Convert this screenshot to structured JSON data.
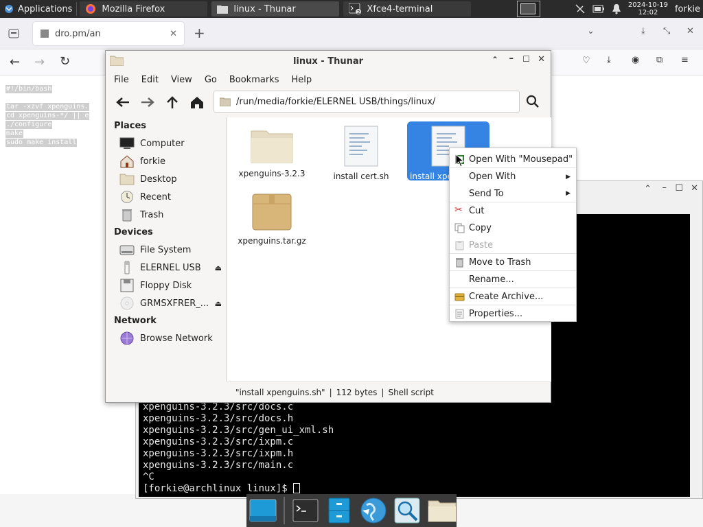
{
  "panel": {
    "applications": "Applications",
    "tasks": [
      {
        "label": "Mozilla Firefox"
      },
      {
        "label": "linux - Thunar"
      },
      {
        "label": "Xfce4-terminal"
      }
    ],
    "clock_date": "2024-10-19",
    "clock_time": "12:02",
    "user": "forkie"
  },
  "firefox": {
    "tab_title": "dro.pm/an",
    "content_lines": [
      "#!/bin/bash",
      "tar -xzvf xpenguins.",
      "cd xpenguins-*/ || e",
      "./configure",
      "make",
      "sudo make install"
    ]
  },
  "terminal": {
    "lines": [
      "xpenguins-3.2.3/src/docs.c",
      "xpenguins-3.2.3/src/docs.h",
      "xpenguins-3.2.3/src/gen_ui_xml.sh",
      "xpenguins-3.2.3/src/ixpm.c",
      "xpenguins-3.2.3/src/ixpm.h",
      "xpenguins-3.2.3/src/main.c",
      "^C",
      "[forkie@archlinux linux]$ "
    ]
  },
  "thunar": {
    "title": "linux - Thunar",
    "menu": [
      "File",
      "Edit",
      "View",
      "Go",
      "Bookmarks",
      "Help"
    ],
    "path": "/run/media/forkie/ELERNEL USB/things/linux/",
    "sidebar": {
      "places_heading": "Places",
      "places": [
        "Computer",
        "forkie",
        "Desktop",
        "Recent",
        "Trash"
      ],
      "devices_heading": "Devices",
      "devices": [
        "File System",
        "ELERNEL USB",
        "Floppy Disk",
        "GRMSXFRER_..."
      ],
      "network_heading": "Network",
      "network": [
        "Browse Network"
      ]
    },
    "files": [
      {
        "name": "xpenguins-3.2.3"
      },
      {
        "name": "install cert.sh"
      },
      {
        "name": "install xpe"
      },
      {
        "name": "xpenguins.tar.gz"
      }
    ],
    "status": {
      "name": "\"install xpenguins.sh\"",
      "size": "112 bytes",
      "type": "Shell script"
    }
  },
  "context_menu": {
    "items": [
      {
        "label": "Open With \"Mousepad\""
      },
      {
        "label": "Open With"
      },
      {
        "label": "Send To"
      },
      {
        "label": "Cut"
      },
      {
        "label": "Copy"
      },
      {
        "label": "Paste"
      },
      {
        "label": "Move to Trash"
      },
      {
        "label": "Rename..."
      },
      {
        "label": "Create Archive..."
      },
      {
        "label": "Properties..."
      }
    ]
  },
  "colors": {
    "selection": "#3584e4",
    "panel_bg": "#2b2b2b",
    "terminal_bg": "#000000"
  }
}
